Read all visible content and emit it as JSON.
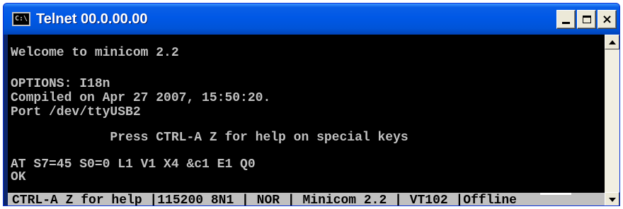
{
  "window": {
    "title": "Telnet 00.0.00.00",
    "icon_label": "C:\\"
  },
  "terminal": {
    "lines": [
      "Welcome to minicom 2.2",
      "OPTIONS: I18n",
      "Compiled on Apr 27 2007, 15:50:20.",
      "Port /dev/ttyUSB2",
      "             Press CTRL-A Z for help on special keys",
      "AT S7=45 S0=0 L1 V1 X4 &c1 E1 Q0",
      "OK"
    ]
  },
  "statusbar": {
    "text": "CTRL-A Z for help |115200 8N1 | NOR | Minicom 2.2 | VT102 |Offline"
  },
  "icons": {
    "window_icon": "console-icon",
    "minimize": "minimize-icon",
    "maximize": "maximize-icon",
    "close": "close-icon",
    "scroll_up": "arrow-up-icon",
    "scroll_down": "arrow-down-icon"
  },
  "colors": {
    "titlebar": "#0058e6",
    "terminal_bg": "#000000",
    "terminal_fg": "#c0c0c0",
    "statusbar_bg": "#c0c0c0"
  }
}
